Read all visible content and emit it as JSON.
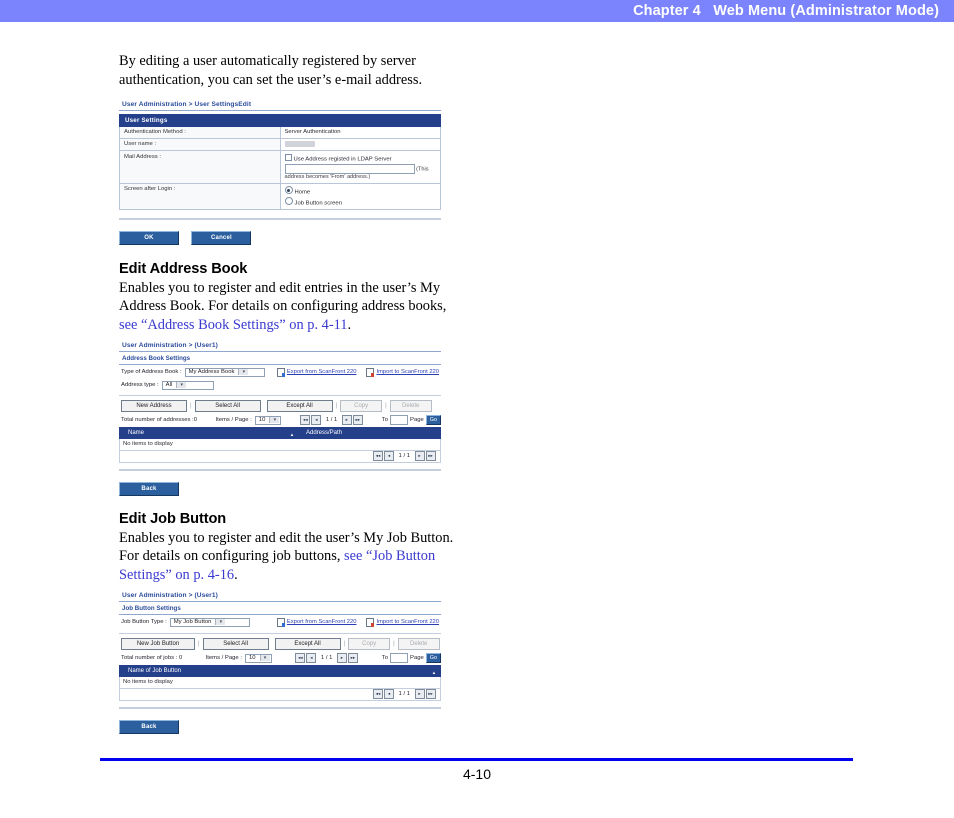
{
  "header": {
    "chapter_label": "Chapter 4",
    "title": "Web Menu (Administrator Mode)",
    "full": "Chapter 4   Web Menu (Administrator Mode)",
    "bar_color": "#7b84fc"
  },
  "footer": {
    "page_number": "4-10",
    "rule_color": "#0000ee"
  },
  "intro": {
    "line1": "By editing a user automatically registered by server",
    "line2": "authentication, you can set the user’s e-mail address."
  },
  "figure_user_settings": {
    "breadcrumb": "User Administration > User SettingsEdit",
    "panel_title": "User Settings",
    "rows": [
      {
        "label": "Authentication Method :",
        "value": "Server Authentication"
      },
      {
        "label": "User name :",
        "value": ""
      },
      {
        "label": "Mail Address :",
        "value": ""
      },
      {
        "label": "Screen after Login :",
        "value": ""
      }
    ],
    "mail": {
      "checkbox_label": "Use Address registed in LDAP Server",
      "checkbox_checked": false,
      "input_value": "",
      "hint": "(This address becomes 'From' address.)"
    },
    "screen_after_login": {
      "option_home": "Home",
      "option_job_button": "Job Button screen",
      "selected": "Home"
    },
    "buttons": {
      "ok": "OK",
      "cancel": "Cancel"
    }
  },
  "section_address_book": {
    "heading": "Edit Address Book",
    "body_line1": "Enables you to register and edit entries in the user’s My",
    "body_line2": "Address Book. For details on configuring address books,",
    "link_text": "see “Address Book Settings” on p. 4-11",
    "link_tail": "."
  },
  "figure_address_book": {
    "breadcrumb": "User Administration > (User1)",
    "panel_title": "Address Book Settings",
    "type_label": "Type of Address Book :",
    "type_value": "My Address Book",
    "address_type_label": "Address type :",
    "address_type_value": "All",
    "export_link": "Export from ScanFront 220",
    "import_link": "Import to ScanFront 220",
    "toolbar": {
      "new": "New Address",
      "select_all": "Select All",
      "except_all": "Except All",
      "copy": "Copy",
      "delete": "Delete"
    },
    "total_label": "Total number of addresses :0",
    "items_per_page_label": "Items / Page :",
    "items_per_page_value": "10",
    "page_indicator": "1 / 1",
    "goto_label": "To",
    "goto_value": "",
    "page_word": "Page",
    "go_button": "Go",
    "columns": [
      "Name",
      "Address/Path"
    ],
    "empty_message": "No items to display",
    "bottom_page_indicator": "1 / 1",
    "back_button": "Back"
  },
  "section_job_button": {
    "heading": "Edit Job Button",
    "body_line1": "Enables you to register and edit the user’s My Job Button.",
    "body_line2_plain": "For details on configuring job buttons, ",
    "link_part1": "see “Job Button",
    "link_part2": "Settings” on p. 4-16",
    "link_tail": "."
  },
  "figure_job_button": {
    "breadcrumb": "User Administration > (User1)",
    "panel_title": "Job Button Settings",
    "type_label": "Job Button Type :",
    "type_value": "My Job Button",
    "export_link": "Export from ScanFront 220",
    "import_link": "Import to ScanFront 220",
    "toolbar": {
      "new": "New Job Button",
      "select_all": "Select All",
      "except_all": "Except All",
      "copy": "Copy",
      "delete": "Delete"
    },
    "total_label": "Total number of jobs : 0",
    "items_per_page_label": "Items / Page :",
    "items_per_page_value": "10",
    "page_indicator": "1 / 1",
    "goto_label": "To",
    "goto_value": "",
    "page_word": "Page",
    "go_button": "Go",
    "columns": [
      "Name of Job Button"
    ],
    "empty_message": "No items to display",
    "bottom_page_indicator": "1 / 1",
    "back_button": "Back"
  },
  "icons": {
    "first_page": "⏮",
    "prev_page": "◀",
    "next_page": "▶",
    "last_page": "⏭",
    "sort_asc": "▲"
  }
}
